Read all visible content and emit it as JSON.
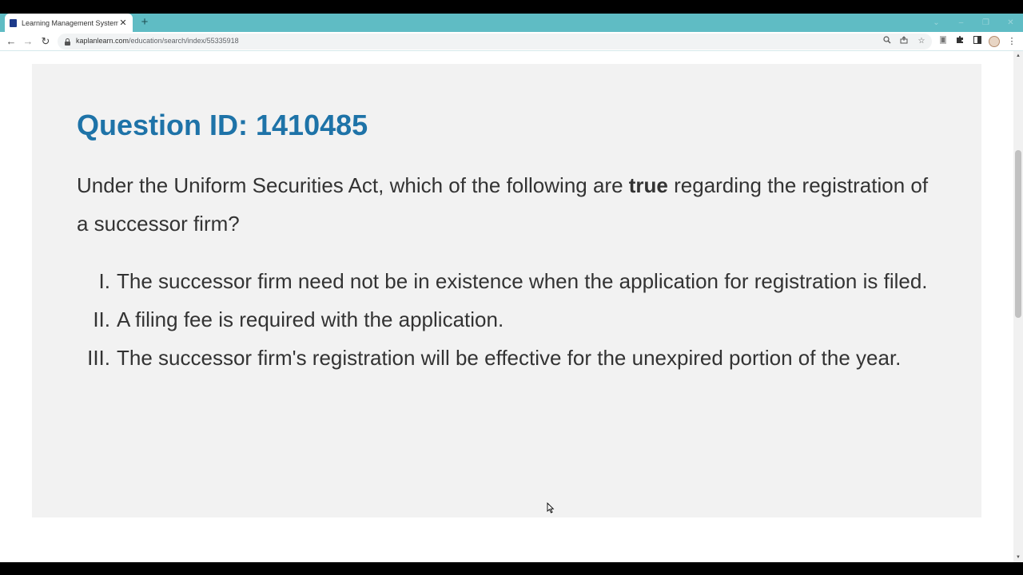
{
  "browser": {
    "tab_title": "Learning Management System",
    "tab_close": "✕",
    "new_tab": "+",
    "url_domain": "kaplanlearn.com",
    "url_path": "/education/search/index/55335918",
    "colors": {
      "tabstrip": "#5fbcc4",
      "accent": "#1e73a8"
    }
  },
  "question": {
    "id_label": "Question ID: 1410485",
    "stem_before": "Under the Uniform Securities Act, which of the following are ",
    "stem_bold": "true",
    "stem_after": " regarding the registration of a successor firm?",
    "options": [
      {
        "numeral": "I.",
        "text": "The successor firm need not be in existence when the application for registration is filed."
      },
      {
        "numeral": "II.",
        "text": "A filing fee is required with the application."
      },
      {
        "numeral": "III.",
        "text": "The successor firm's registration will be effective for the unexpired portion of the year."
      }
    ]
  }
}
